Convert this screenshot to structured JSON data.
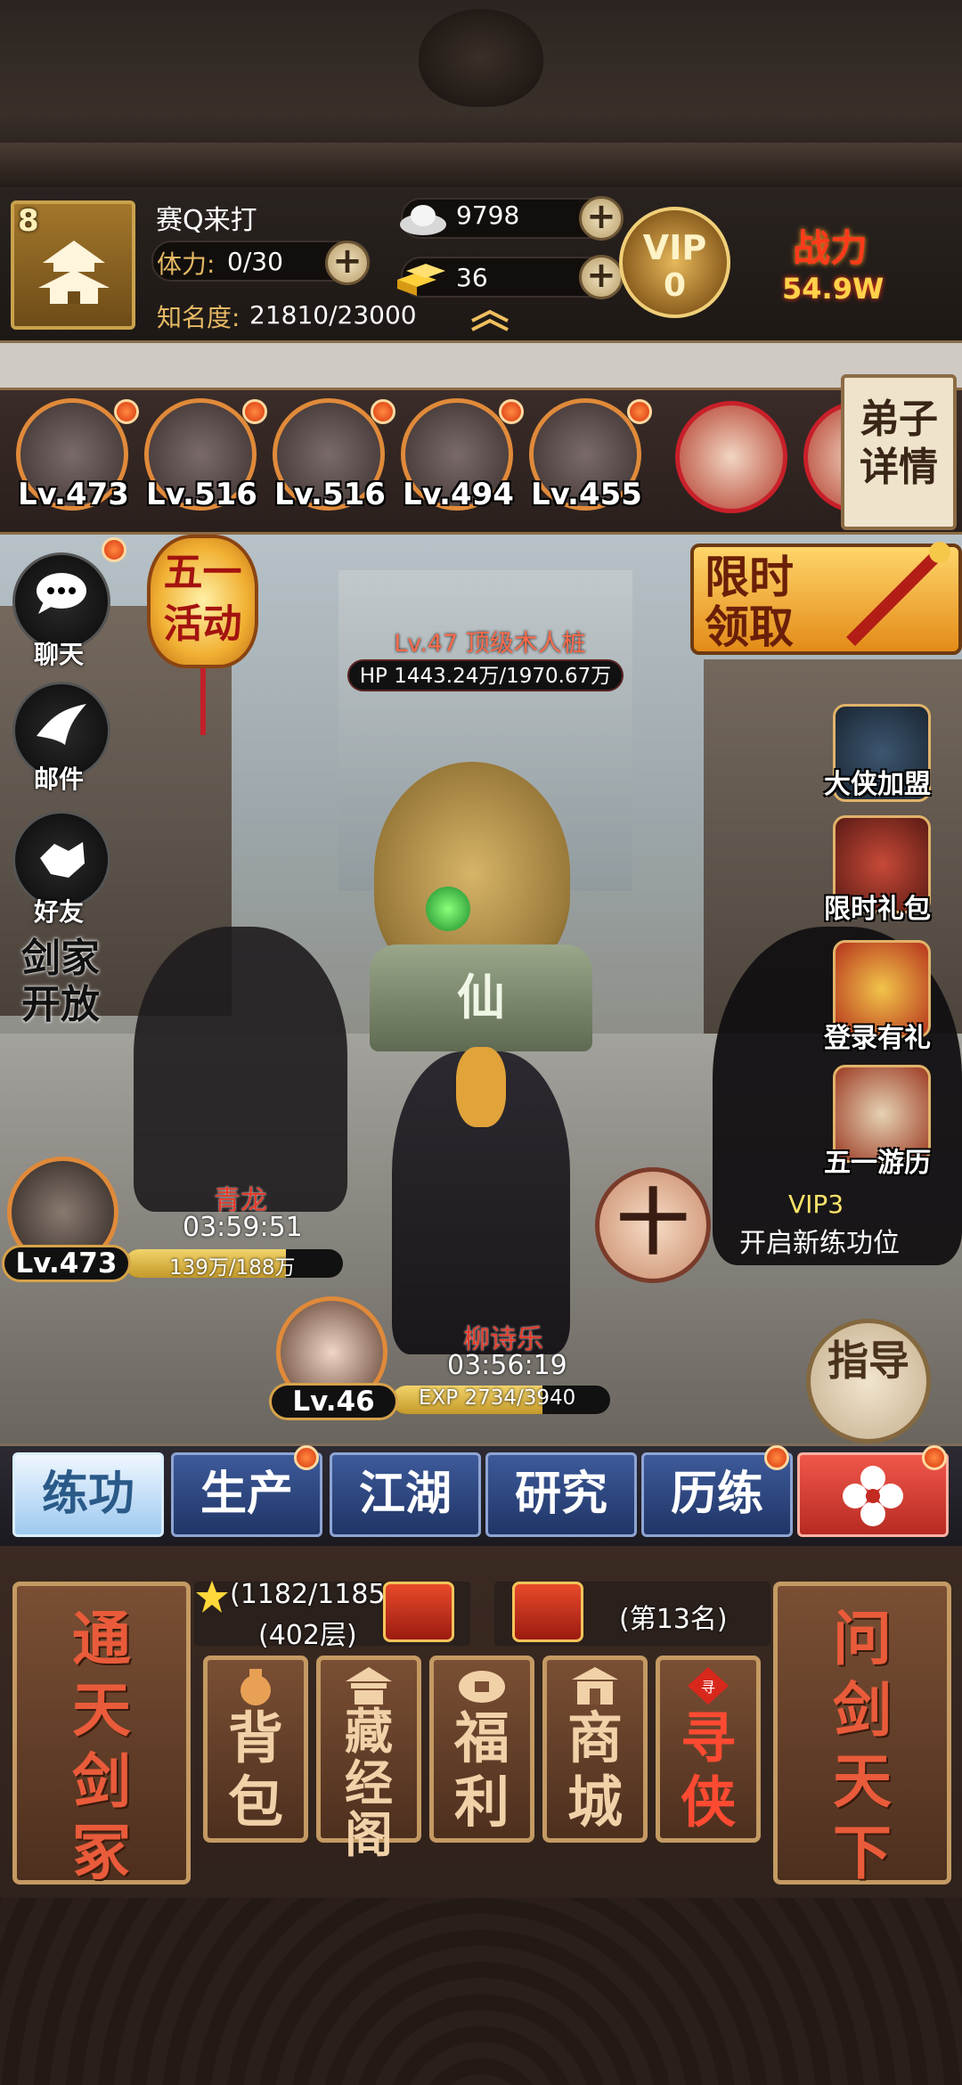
{
  "header": {
    "player_level": "8",
    "player_name": "赛Q来打",
    "stamina_label": "体力:",
    "stamina_value": "0/30",
    "fame_label": "知名度:",
    "fame_value": "21810/23000",
    "silver": "9798",
    "gold": "36",
    "vip_label": "VIP",
    "vip_level": "0",
    "power_label": "战力",
    "power_value": "54.9W"
  },
  "disciples": {
    "items": [
      {
        "level": "Lv.473"
      },
      {
        "level": "Lv.516"
      },
      {
        "level": "Lv.516"
      },
      {
        "level": "Lv.494"
      },
      {
        "level": "Lv.455"
      }
    ],
    "detail_label": "弟子详情"
  },
  "left_menu": {
    "chat": "聊天",
    "mail": "邮件",
    "friends": "好友",
    "sword_family": "剑家开放"
  },
  "event": {
    "lantern": "五一活动",
    "limited_claim": "限时领取"
  },
  "boss": {
    "name": "Lv.47 顶级木人桩",
    "hp": "HP 1443.24万/1970.67万",
    "pedestal": "仙"
  },
  "right_menu": {
    "alliance": "大侠加盟",
    "gift": "限时礼包",
    "login": "登录有礼",
    "travel": "五一游历"
  },
  "unit1": {
    "name": "青龙",
    "time": "03:59:51",
    "level": "Lv.473",
    "progress": "139万/188万",
    "fill": 0.74
  },
  "unit2": {
    "name": "柳诗乐",
    "time": "03:56:19",
    "level": "Lv.46",
    "progress": "EXP 2734/3940",
    "fill": 0.69
  },
  "slot": {
    "plus": "十",
    "vip": "VIP3",
    "text": "开启新练功位"
  },
  "guide": "指导",
  "tabs": [
    "练功",
    "生产",
    "江湖",
    "研究",
    "历练"
  ],
  "bottom": {
    "tower_progress": "(1182/1185)",
    "tower_floor": "(402层)",
    "rank": "(第13名)",
    "left_card": "通天剑冢",
    "right_card": "问剑天下",
    "cards": [
      "背包",
      "藏经阁",
      "福利",
      "商城",
      "寻侠"
    ]
  }
}
